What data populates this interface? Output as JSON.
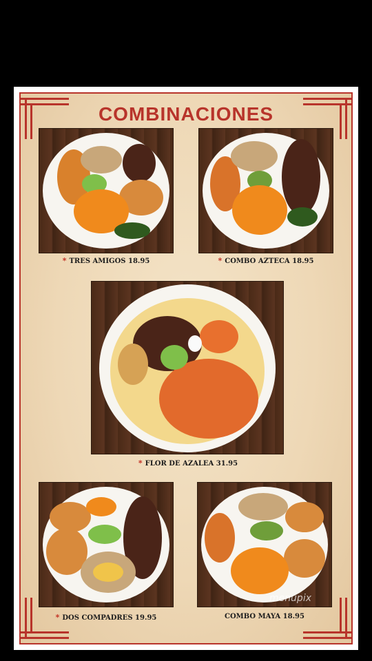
{
  "title": "COMBINACIONES",
  "items": [
    {
      "name": "TRES AMIGOS 18.95",
      "starred": true
    },
    {
      "name": "COMBO AZTECA 18.95",
      "starred": true
    },
    {
      "name": "FLOR DE AZALEA 31.95",
      "starred": true
    },
    {
      "name": "DOS COMPADRES 19.95",
      "starred": true
    },
    {
      "name": "COMBO MAYA 18.95",
      "starred": false
    }
  ],
  "star_glyph": "*",
  "watermark": "menupix",
  "colors": {
    "accent": "#b8342b",
    "background": "#000000",
    "paper": "#f2e0c3"
  }
}
